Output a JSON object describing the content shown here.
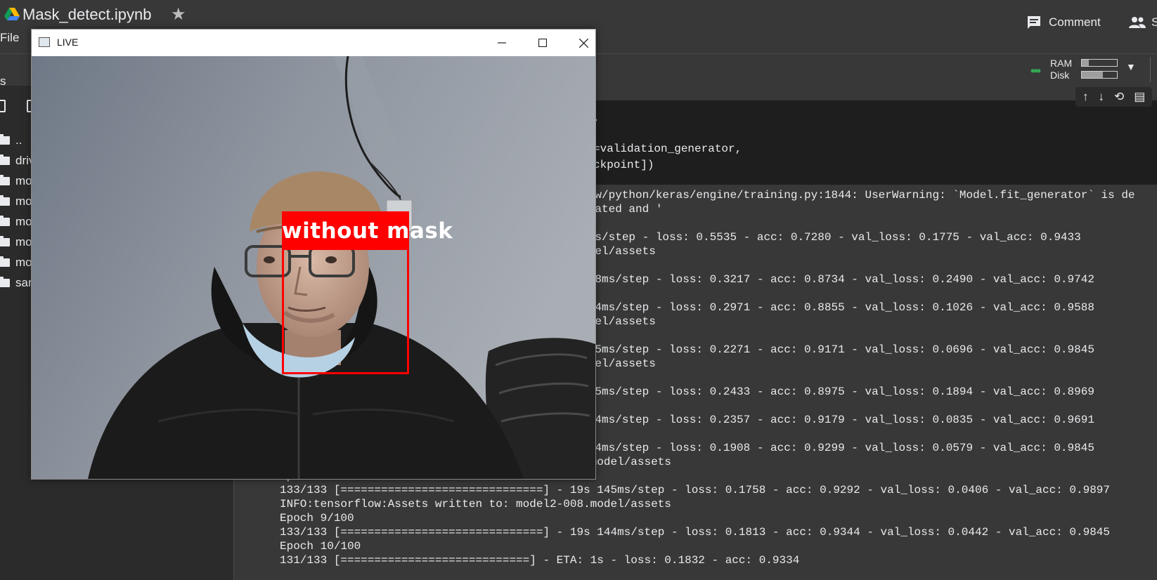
{
  "app": {
    "notebook_title": "Mask_detect.ipynb",
    "menu_file": "File",
    "comment_label": "Comment",
    "share_label": "S",
    "star_icon": "star-icon",
    "colors": {
      "bg": "#383838",
      "sidebar": "#2b2b2b",
      "accent_green": "#34a853"
    }
  },
  "resources": {
    "ram_label": "RAM",
    "disk_label": "Disk",
    "ram_usage": 0.2,
    "disk_usage": 0.6
  },
  "sidebar": {
    "title": "s",
    "items": [
      {
        "label": ".."
      },
      {
        "label": "driv"
      },
      {
        "label": "mo"
      },
      {
        "label": "mo"
      },
      {
        "label": "mo"
      },
      {
        "label": "mo"
      },
      {
        "label": "mo"
      },
      {
        "label": "sar"
      }
    ]
  },
  "cell_tools": [
    "↑",
    "↓",
    "⟲",
    "▤"
  ],
  "code_lines": [
    ",",
    "=validation_generator,",
    "ckpoint])"
  ],
  "output_lines": [
    "rflow/python/keras/engine/training.py:1844: UserWarning: `Model.fit_generator` is de",
    "precated and '",
    "",
    "7s 6s/step - loss: 0.5535 - acc: 0.7280 - val_loss: 0.1775 - val_acc: 0.9433",
    ".model/assets",
    "",
    "s 148ms/step - loss: 0.3217 - acc: 0.8734 - val_loss: 0.2490 - val_acc: 0.9742",
    "",
    "s 144ms/step - loss: 0.2971 - acc: 0.8855 - val_loss: 0.1026 - val_acc: 0.9588",
    ".model/assets",
    "",
    "s 145ms/step - loss: 0.2271 - acc: 0.9171 - val_loss: 0.0696 - val_acc: 0.9845",
    ".model/assets",
    "",
    "s 145ms/step - loss: 0.2433 - acc: 0.8975 - val_loss: 0.1894 - val_acc: 0.8969",
    "",
    "s 144ms/step - loss: 0.2357 - acc: 0.9179 - val_loss: 0.0835 - val_acc: 0.9691",
    "",
    "s 144ms/step - loss: 0.1908 - acc: 0.9299 - val_loss: 0.0579 - val_acc: 0.9845",
    "INFO:tensorflow:Assets written to: model2-007.model/assets",
    "Epoch 8/100",
    "133/133 [==============================] - 19s 145ms/step - loss: 0.1758 - acc: 0.9292 - val_loss: 0.0406 - val_acc: 0.9897",
    "INFO:tensorflow:Assets written to: model2-008.model/assets",
    "Epoch 9/100",
    "133/133 [==============================] - 19s 144ms/step - loss: 0.1813 - acc: 0.9344 - val_loss: 0.0442 - val_acc: 0.9845",
    "Epoch 10/100",
    "131/133 [============================] - ETA: 1s - loss: 0.1832 - acc: 0.9334"
  ],
  "live_window": {
    "title": "LIVE",
    "detection_label": "without mask",
    "detection_color": "#ff0000"
  }
}
